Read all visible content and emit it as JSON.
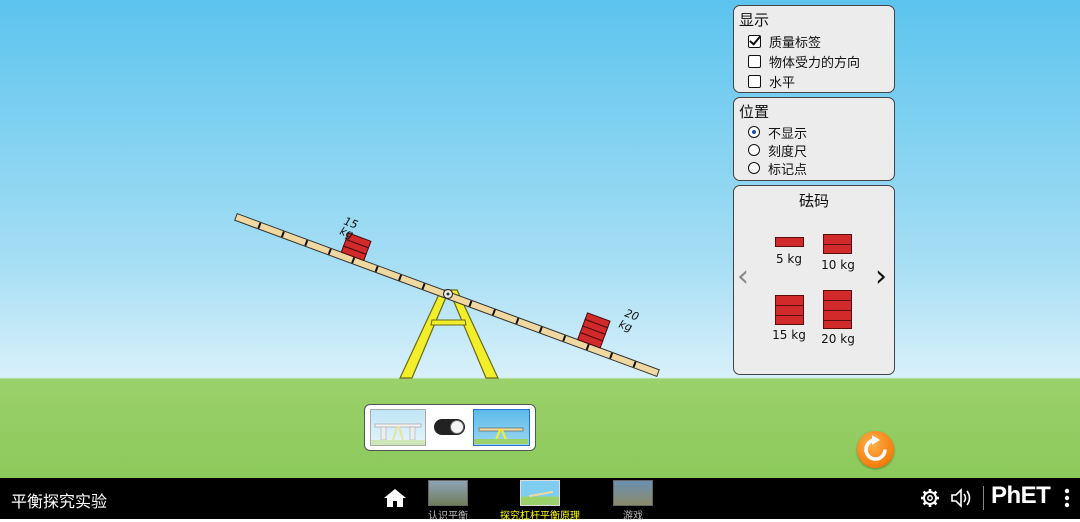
{
  "scene": {
    "plank_left_mass": {
      "value": "15",
      "unit": "kg"
    },
    "plank_right_mass": {
      "value": "20",
      "unit": "kg"
    }
  },
  "display_panel": {
    "title": "显示",
    "items": [
      {
        "label": "质量标签",
        "checked": true
      },
      {
        "label": "物体受力的方向",
        "checked": false
      },
      {
        "label": "水平",
        "checked": false
      }
    ]
  },
  "position_panel": {
    "title": "位置",
    "items": [
      {
        "label": "不显示",
        "selected": true
      },
      {
        "label": "刻度尺",
        "selected": false
      },
      {
        "label": "标记点",
        "selected": false
      }
    ]
  },
  "weights_panel": {
    "title": "砝码",
    "weights": [
      "5 kg",
      "10 kg",
      "15 kg",
      "20 kg"
    ],
    "prev_arrow": "‹",
    "next_arrow": "›"
  },
  "navbar": {
    "sim_title": "平衡探究实验",
    "tabs": [
      "认识平衡",
      "探究杠杆平衡原理",
      "游戏"
    ],
    "active_tab": "探究杠杆平衡原理",
    "brand": "PhET",
    "colors": {
      "active_tab": "#ffff00",
      "inactive_tab": "#bbbbbb",
      "brand": "#ffffff"
    }
  },
  "icons": [
    "home-icon",
    "settings-gear-icon",
    "sound-icon",
    "more-options-icon",
    "reset-icon"
  ]
}
